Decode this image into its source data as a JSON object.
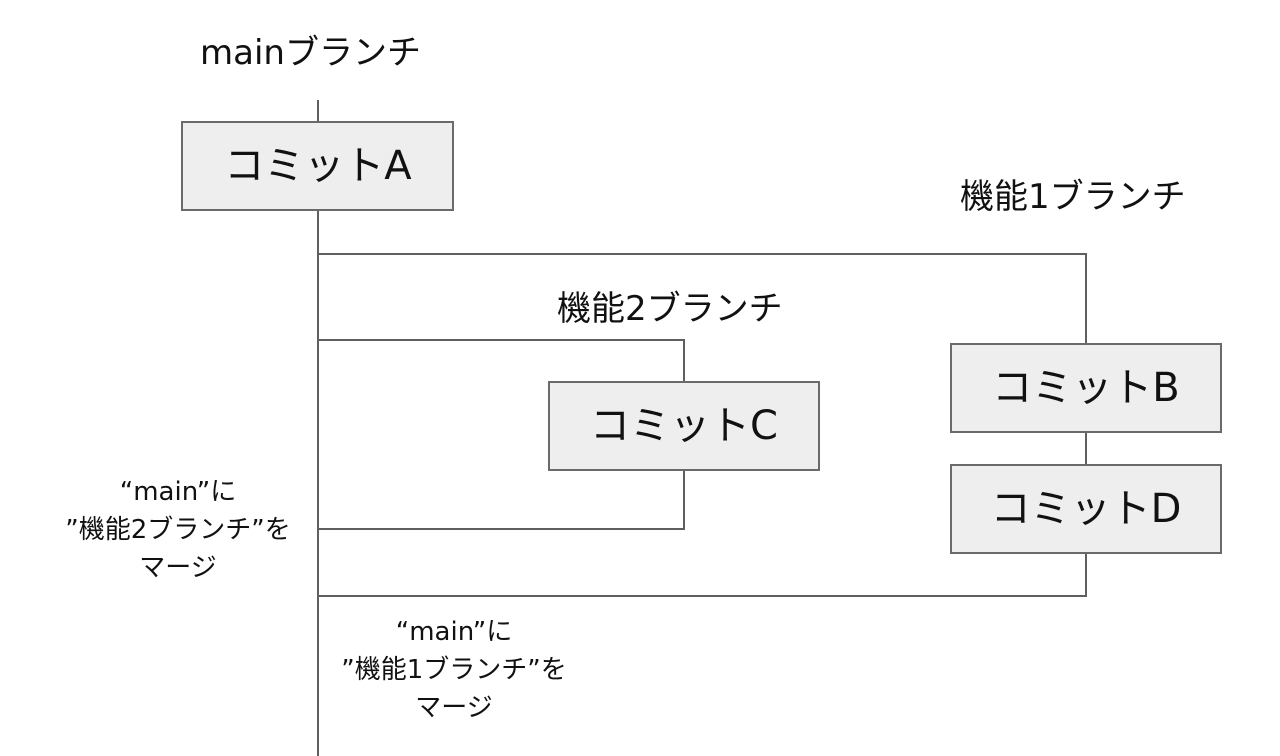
{
  "branches": {
    "main": "mainブランチ",
    "feature1": "機能1ブランチ",
    "feature2": "機能2ブランチ"
  },
  "commits": {
    "a": "コミットA",
    "b": "コミットB",
    "c": "コミットC",
    "d": "コミットD"
  },
  "notes": {
    "merge_feature2": [
      "“main”に",
      "”機能2ブランチ”を",
      "マージ"
    ],
    "merge_feature1": [
      "“main”に",
      "”機能1ブランチ”を",
      "マージ"
    ]
  }
}
